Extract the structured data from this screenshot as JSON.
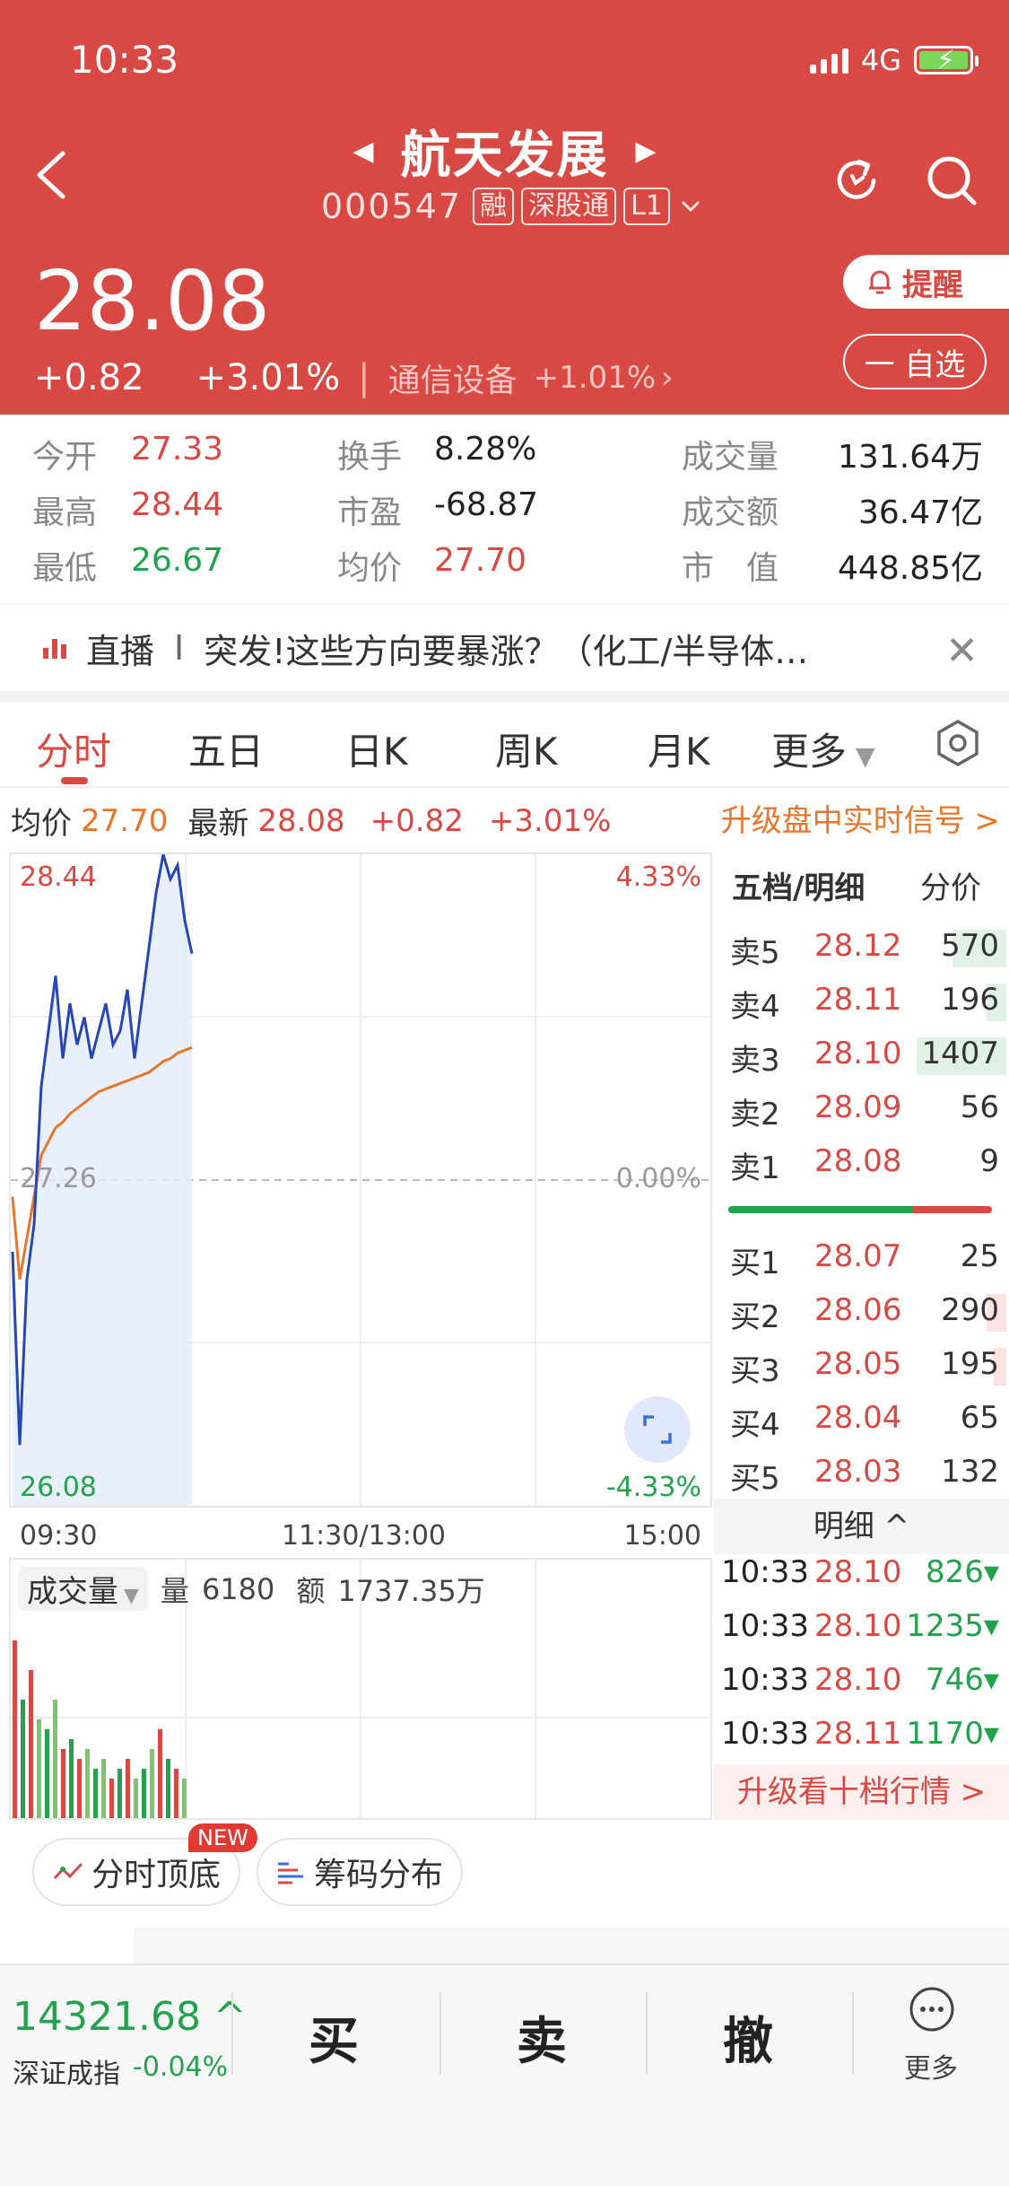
{
  "status_bar": {
    "time": "10:33",
    "network": "4G"
  },
  "header": {
    "stock_name": "航天发展",
    "code": "000547",
    "tags": [
      "融",
      "深股通",
      "L1"
    ],
    "price": "28.08",
    "change": "+0.82",
    "change_pct": "+3.01%",
    "industry": "通信设备",
    "industry_change": "+1.01%",
    "remind_label": "提醒",
    "watchlist_label": "一 自选"
  },
  "stats": {
    "open_label": "今开",
    "open": "27.33",
    "high_label": "最高",
    "high": "28.44",
    "low_label": "最低",
    "low": "26.67",
    "turnover_label": "换手",
    "turnover": "8.28%",
    "pe_label": "市盈",
    "pe": "-68.87",
    "avg_label": "均价",
    "avg": "27.70",
    "volume_label": "成交量",
    "volume": "131.64万",
    "amount_label": "成交额",
    "amount": "36.47亿",
    "mktcap_label": "市　值",
    "mktcap": "448.85亿"
  },
  "live": {
    "label": "直播",
    "divider": "I",
    "text": "突发!这些方向要暴涨？（化工/半导体…"
  },
  "tabs": [
    "分时",
    "五日",
    "日K",
    "周K",
    "月K",
    "更多"
  ],
  "info_row": {
    "avg_label": "均价",
    "avg": "27.70",
    "latest_label": "最新",
    "latest": "28.08",
    "change": "+0.82",
    "change_pct": "+3.01%",
    "upgrade_link": "升级盘中实时信号 >"
  },
  "chart": {
    "top_price": "28.44",
    "top_pct": "4.33%",
    "mid_price": "27.26",
    "mid_pct": "0.00%",
    "bottom_price": "26.08",
    "bottom_pct": "-4.33%",
    "times": [
      "09:30",
      "11:30/13:00",
      "15:00"
    ],
    "volume_label": "成交量",
    "vol_label": "量",
    "vol": "6180",
    "amt_label": "额",
    "amt": "1737.35万"
  },
  "chart_data": {
    "type": "line",
    "ylim": [
      26.08,
      28.44
    ],
    "prev_close": 27.26,
    "series": [
      {
        "values": [
          27.0,
          26.3,
          26.9,
          27.1,
          27.6,
          27.8,
          28.0,
          27.7,
          27.9,
          27.75,
          27.85,
          27.7,
          27.8,
          27.9,
          27.75,
          27.8,
          27.95,
          27.7,
          27.9,
          28.1,
          28.3,
          28.44,
          28.35,
          28.4,
          28.2,
          28.08
        ]
      },
      {
        "values": [
          27.2,
          26.9,
          27.05,
          27.2,
          27.35,
          27.4,
          27.45,
          27.47,
          27.5,
          27.52,
          27.54,
          27.56,
          27.58,
          27.59,
          27.6,
          27.61,
          27.62,
          27.63,
          27.64,
          27.65,
          27.67,
          27.69,
          27.7,
          27.72,
          27.73,
          27.74
        ]
      }
    ]
  },
  "order_book": {
    "title": "五档/明细",
    "alt": "分价",
    "asks": [
      {
        "label": "卖5",
        "price": "28.12",
        "qty": "570"
      },
      {
        "label": "卖4",
        "price": "28.11",
        "qty": "196"
      },
      {
        "label": "卖3",
        "price": "28.10",
        "qty": "1407"
      },
      {
        "label": "卖2",
        "price": "28.09",
        "qty": "56"
      },
      {
        "label": "卖1",
        "price": "28.08",
        "qty": "9"
      }
    ],
    "bids": [
      {
        "label": "买1",
        "price": "28.07",
        "qty": "25"
      },
      {
        "label": "买2",
        "price": "28.06",
        "qty": "290"
      },
      {
        "label": "买3",
        "price": "28.05",
        "qty": "195"
      },
      {
        "label": "买4",
        "price": "28.04",
        "qty": "65"
      },
      {
        "label": "买5",
        "price": "28.03",
        "qty": "132"
      }
    ],
    "detail_label": "明细 ^",
    "trades": [
      {
        "time": "10:33",
        "price": "28.10",
        "vol": "826▾"
      },
      {
        "time": "10:33",
        "price": "28.10",
        "vol": "1235▾"
      },
      {
        "time": "10:33",
        "price": "28.10",
        "vol": "746▾"
      },
      {
        "time": "10:33",
        "price": "28.11",
        "vol": "1170▾"
      }
    ],
    "upgrade_label": "升级看十档行情 >"
  },
  "features": {
    "top_bottom": "分时顶底",
    "new": "NEW",
    "chips": "筹码分布"
  },
  "bottom": {
    "index_value": "14321.68 ^",
    "index_name": "深证成指",
    "index_change": "-0.04%",
    "buy": "买",
    "sell": "卖",
    "cancel": "撤",
    "more": "更多"
  },
  "colors": {
    "brand": "#d94944",
    "up": "#d94944",
    "down": "#23a24d",
    "price_line": "#2446b8",
    "avg_line": "#e8752c"
  }
}
